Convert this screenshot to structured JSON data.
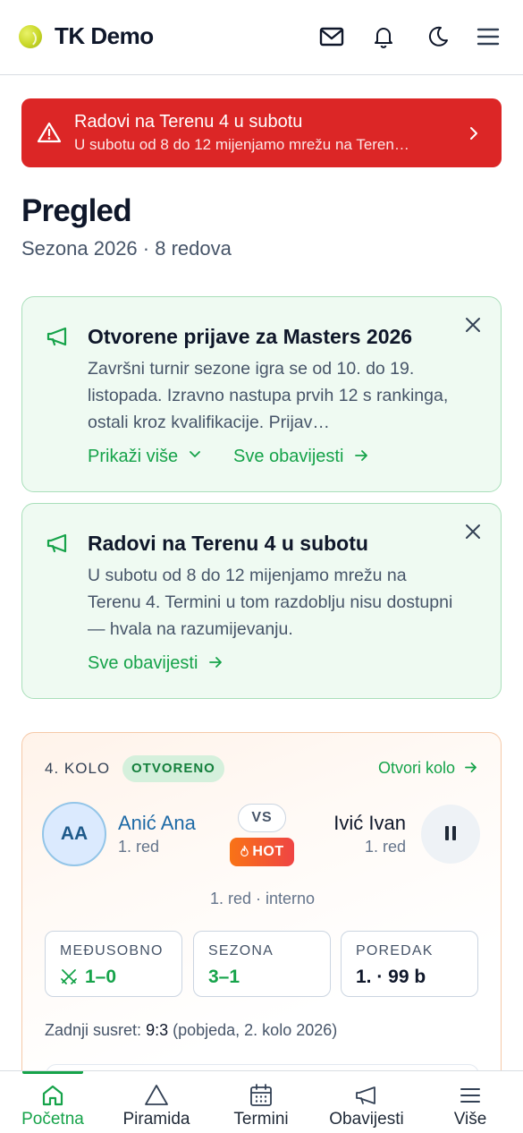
{
  "header": {
    "title": "TK Demo",
    "icons": [
      "mail-icon",
      "bell-icon",
      "moon-icon",
      "menu-icon"
    ]
  },
  "banner": {
    "title": "Radovi na Terenu 4 u subotu",
    "text": "U subotu od 8 do 12 mijenjamo mrežu na Teren…",
    "color": "#dc2626"
  },
  "page": {
    "title": "Pregled",
    "subtitle": "Sezona 2026 · 8 redova"
  },
  "notices": [
    {
      "title": "Otvorene prijave za Masters 2026",
      "body": "Završni turnir sezone igra se od 10. do 19. listopada. Izravno nastupa prvih 12 s rankinga, ostali kroz kvalifikacije. Prijav…",
      "show_more": "Prikaži više",
      "all_link": "Sve obavijesti"
    },
    {
      "title": "Radovi na Terenu 4 u subotu",
      "body": "U subotu od 8 do 12 mijenjamo mrežu na Terenu 4. Termini u tom razdoblju nisu dostupni — hvala na razumijevanju.",
      "all_link": "Sve obavijesti"
    }
  ],
  "match": {
    "round": "4. KOLO",
    "status": "OTVORENO",
    "open_link": "Otvori kolo",
    "player1": {
      "initials": "AA",
      "name": "Anić Ana",
      "row": "1. red"
    },
    "vs": "VS",
    "hot": "HOT",
    "player2": {
      "name": "Ivić Ivan",
      "row": "1. red"
    },
    "meta": "1. red · interno",
    "stats": [
      {
        "label": "MEĐUSOBNO",
        "value": "1–0"
      },
      {
        "label": "SEZONA",
        "value": "3–1"
      },
      {
        "label": "POREDAK",
        "value": "1. · 99 b"
      }
    ],
    "last_meet": {
      "label": "Zadnji susret:",
      "score": "9:3",
      "detail": "(pobjeda, 2. kolo 2026)"
    }
  },
  "bottom_nav": [
    {
      "label": "Početna",
      "icon": "home-icon",
      "active": true
    },
    {
      "label": "Piramida",
      "icon": "pyramid-icon",
      "active": false
    },
    {
      "label": "Termini",
      "icon": "calendar-icon",
      "active": false
    },
    {
      "label": "Obavijesti",
      "icon": "megaphone-icon",
      "active": false
    },
    {
      "label": "Više",
      "icon": "menu-icon",
      "active": false
    }
  ],
  "colors": {
    "accent": "#16a34a",
    "alert": "#dc2626",
    "hot": "#f97316"
  }
}
